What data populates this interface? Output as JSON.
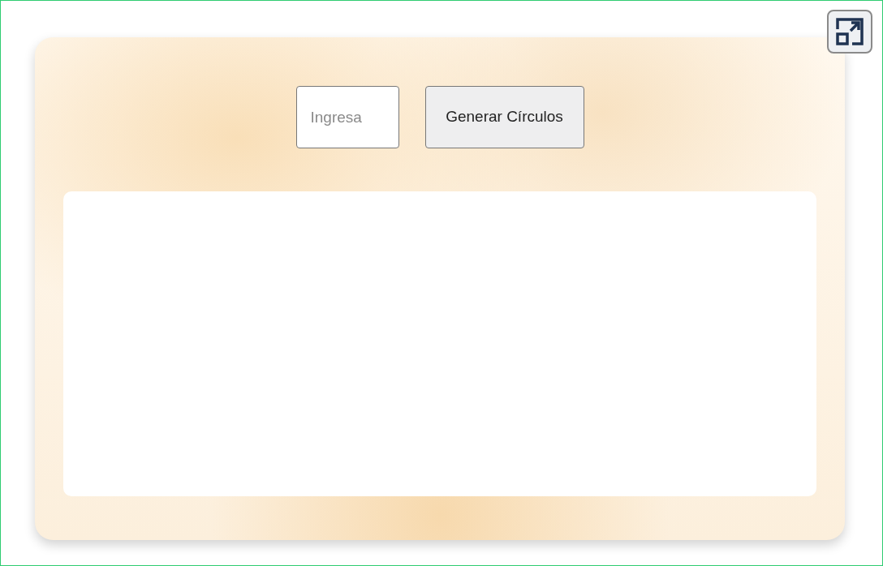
{
  "input": {
    "placeholder": "Ingresa"
  },
  "button": {
    "label": "Generar Círculos"
  }
}
